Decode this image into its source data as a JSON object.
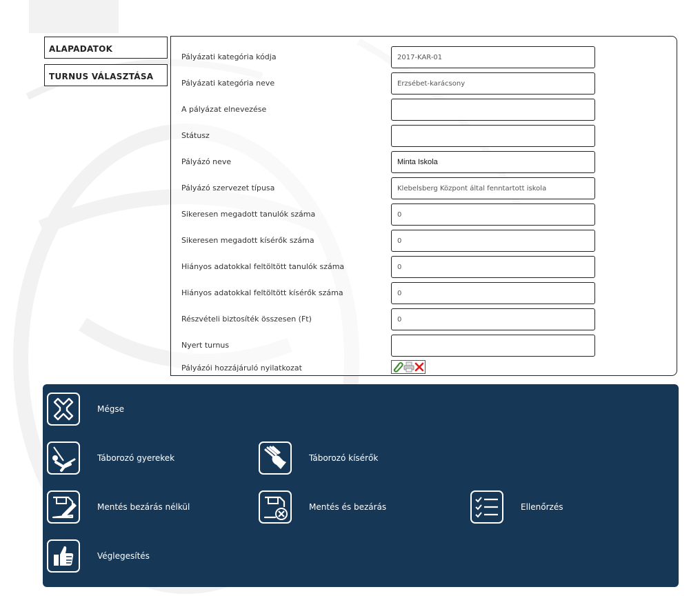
{
  "tabs": [
    {
      "label": "ALAPADATOK"
    },
    {
      "label": "TURNUS VÁLASZTÁSA"
    }
  ],
  "form": {
    "fields": [
      {
        "label": "Pályázati kategória kódja",
        "value": "2017-KAR-01"
      },
      {
        "label": "Pályázati kategória neve",
        "value": "Erzsébet-karácsony"
      },
      {
        "label": "A pályázat elnevezése",
        "value": ""
      },
      {
        "label": "Státusz",
        "value": ""
      },
      {
        "label": "Pályázó neve",
        "value": "Minta Iskola"
      },
      {
        "label": "Pályázó szervezet típusa",
        "value": "Klebelsberg Központ által fenntartott iskola"
      },
      {
        "label": "Sikeresen megadott tanulók száma",
        "value": "0"
      },
      {
        "label": "Sikeresen megadott kísérők száma",
        "value": "0"
      },
      {
        "label": "Hiányos adatokkal feltöltött tanulók száma",
        "value": "0"
      },
      {
        "label": "Hiányos adatokkal feltöltött kísérők száma",
        "value": "0"
      },
      {
        "label": "Részvételi biztosíték összesen (Ft)",
        "value": "0"
      },
      {
        "label": "Nyert turnus",
        "value": ""
      }
    ],
    "attachment": {
      "label": "Pályázói hozzájáruló nyilatkozat",
      "icons": [
        "attach-icon",
        "printer-icon",
        "delete-icon"
      ]
    }
  },
  "actions": {
    "cancel": {
      "label": "Mégse",
      "icon": "close-x-icon"
    },
    "children": {
      "label": "Táborozó gyerekek",
      "icon": "swing-child-icon"
    },
    "companions": {
      "label": "Táborozó kísérők",
      "icon": "holding-hands-icon"
    },
    "save_no_close": {
      "label": "Mentés bezárás nélkül",
      "icon": "save-edit-icon"
    },
    "save_close": {
      "label": "Mentés és bezárás",
      "icon": "save-close-icon"
    },
    "check": {
      "label": "Ellenőrzés",
      "icon": "checklist-icon"
    },
    "finalize": {
      "label": "Véglegesítés",
      "icon": "thumbs-up-icon"
    }
  },
  "colors": {
    "action_panel_bg": "#163756",
    "border": "#222222",
    "delete_red": "#e01818",
    "attach_green": "#3a8a2a"
  }
}
